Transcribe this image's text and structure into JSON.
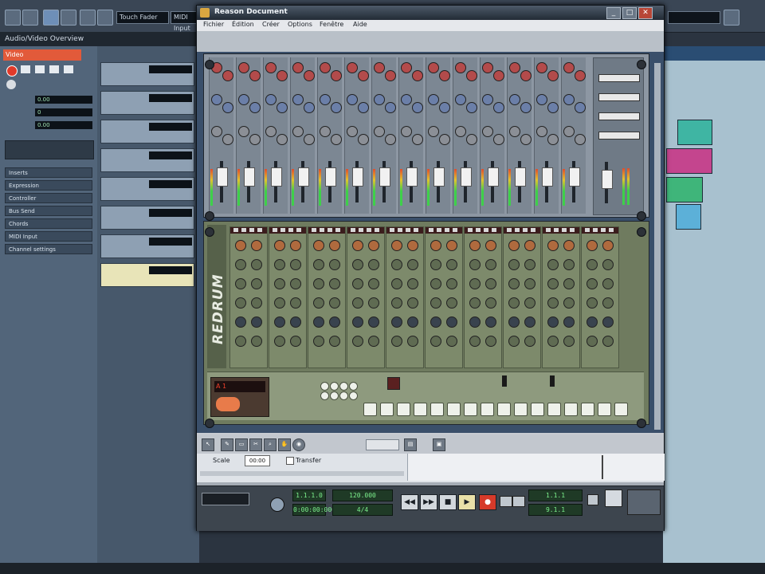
{
  "background": {
    "inspector_title": "Audio/Video Overview",
    "track_name": "Video",
    "inspector_rows": [
      "Inserts",
      "Expression",
      "Controller",
      "Bus Send",
      "Chords",
      "MIDI Input",
      "Channel settings"
    ],
    "inspector_values": [
      "0.00",
      "0",
      "0.00"
    ],
    "toolbar_fields": [
      "Touch Fader",
      "MIDI Input"
    ],
    "colors": {
      "accent": "#e25a3a",
      "inspector": "#52657a",
      "arrange": "#a8c1cf"
    }
  },
  "window": {
    "title": "Reason Document",
    "menu": [
      "Fichier",
      "Édition",
      "Créer",
      "Options",
      "Fenêtre",
      "Aide"
    ],
    "minimize": "_",
    "maximize": "□",
    "close": "✕"
  },
  "mixer": {
    "channels": 14
  },
  "redrum": {
    "logo": "REDRUM",
    "channels": 10,
    "steps": 16,
    "pattern_display": "A 1"
  },
  "sequencer": {
    "tools": [
      "arrow",
      "pencil",
      "eraser",
      "razor",
      "magnify",
      "hand"
    ],
    "lane_label": "Scale",
    "lane_value": "00:00",
    "lane_check_label": "Transfer"
  },
  "transport": {
    "position": "1.1.1.0",
    "time": "0:00:00:000",
    "tempo": "120.000",
    "signature": "4/4",
    "left_locator": "1.1.1",
    "right_locator": "9.1.1",
    "buttons": {
      "stop": "■",
      "play": "▶",
      "rewind": "◀◀",
      "forward": "▶▶",
      "record": "●"
    }
  }
}
